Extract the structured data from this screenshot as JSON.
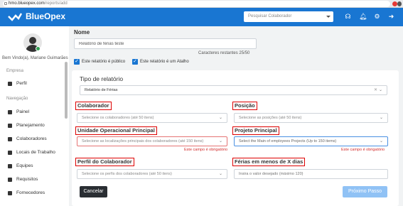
{
  "browser": {
    "host": "hmo.blueopex.com",
    "path": "/reports/add"
  },
  "topnav": {
    "brand": "BlueOpex",
    "search_placeholder": "Pesquisar Colaborador"
  },
  "sidebar": {
    "welcome": "Bem Vindo(a), Mariane Guimarães",
    "sections": [
      {
        "title": "Empresa",
        "items": [
          {
            "label": "Perfil",
            "icon": "user-icon"
          }
        ]
      },
      {
        "title": "Navegação",
        "items": [
          {
            "label": "Painel",
            "icon": "dashboard-icon"
          },
          {
            "label": "Planejamento",
            "icon": "calendar-icon"
          },
          {
            "label": "Colaboradores",
            "icon": "users-icon"
          },
          {
            "label": "Locais de Trabalho",
            "icon": "building-icon"
          },
          {
            "label": "Equipes",
            "icon": "team-icon"
          },
          {
            "label": "Requisitos",
            "icon": "check-icon"
          },
          {
            "label": "Fornecedores",
            "icon": "truck-icon"
          }
        ]
      }
    ]
  },
  "form": {
    "name_label": "Nome",
    "name_value": "Relatório de férias teste",
    "counter": "Caracteres restantes 25/50",
    "public_label": "Este relatório é público",
    "shortcut_label": "Este relatório é um Atalho",
    "type_label": "Tipo de relatório",
    "type_value": "Relatório de Férias",
    "fields": {
      "colaborador": {
        "label": "Colaborador",
        "placeholder": "Selecione os colaboradores (até 50 itens)"
      },
      "posicao": {
        "label": "Posição",
        "placeholder": "Selecione as posições (até 50 itens)"
      },
      "unidade": {
        "label": "Unidade Operacional Principal",
        "placeholder": "Selecione as localizações principais dos colaboradores (até 150 itens)",
        "error": "Este campo é obrigatório"
      },
      "projeto": {
        "label": "Projeto Principal",
        "placeholder": "Select the Main of employees Projects (Up to 150 items)",
        "error": "Este campo é obrigatório"
      },
      "perfil": {
        "label": "Perfil do Colaborador",
        "placeholder": "Selecione os perfis dos colaboradores (até 50 itens)"
      },
      "ferias": {
        "label": "Férias em menos de X dias",
        "placeholder": "Insira o valor desejado (máximo 120)"
      }
    },
    "cancel": "Cancelar",
    "next": "Próximo Passo"
  },
  "colors": {
    "primary": "#1976d2",
    "error": "#d32f2f",
    "dark_button": "#2a2e33",
    "next_button": "#90c2f5"
  }
}
